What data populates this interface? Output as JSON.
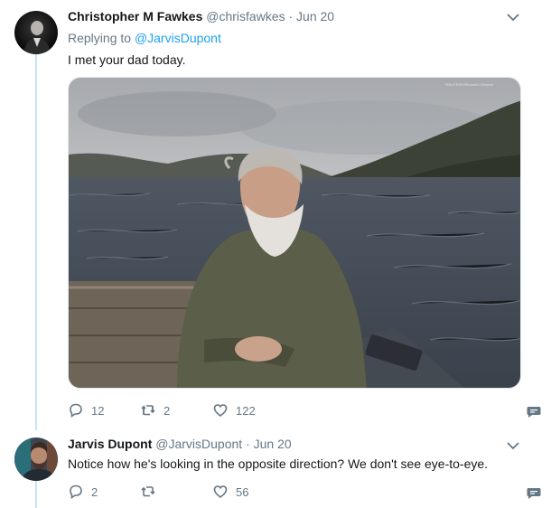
{
  "tweet1": {
    "author_name": "Christopher M Fawkes",
    "author_handle": "@chrisfawkes",
    "date": "· Jun 20",
    "replying_label": "Replying to",
    "replying_handle": "@JarvisDupont",
    "text": "I met your dad today.",
    "image_credit": "REUTERS/Russell Cheyne",
    "replies": "12",
    "retweets": "2",
    "likes": "122"
  },
  "tweet2": {
    "author_name": "Jarvis Dupont",
    "author_handle": "@JarvisDupont",
    "date": "· Jun 20",
    "text": "Notice how he's looking in the opposite direction? We don't see eye-to-eye.",
    "replies": "2",
    "retweets": "",
    "likes": "56"
  },
  "icons": {
    "reply": "reply-icon",
    "retweet": "retweet-icon",
    "like": "heart-icon",
    "dm": "direct-message-icon",
    "more": "chevron-down-icon"
  },
  "colors": {
    "link": "#1da1f2",
    "muted": "#657786",
    "thread_line": "#c4e4f7"
  }
}
